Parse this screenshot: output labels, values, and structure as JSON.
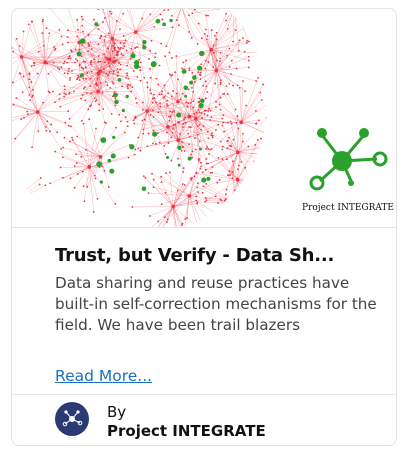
{
  "card": {
    "banner": {
      "brand_label": "Project INTEGRATE",
      "network_color": "#ee3344",
      "node_color": "#2aa12a"
    },
    "title": "Trust, but Verify - Data Sh...",
    "description": "Data sharing and reuse practices have built-in self-correction mechanisms for the field. We have been trail blazers",
    "read_more": "Read More...",
    "author": {
      "by_label": "By",
      "name": "Project INTEGRATE",
      "avatar_color": "#2c3a73"
    }
  }
}
